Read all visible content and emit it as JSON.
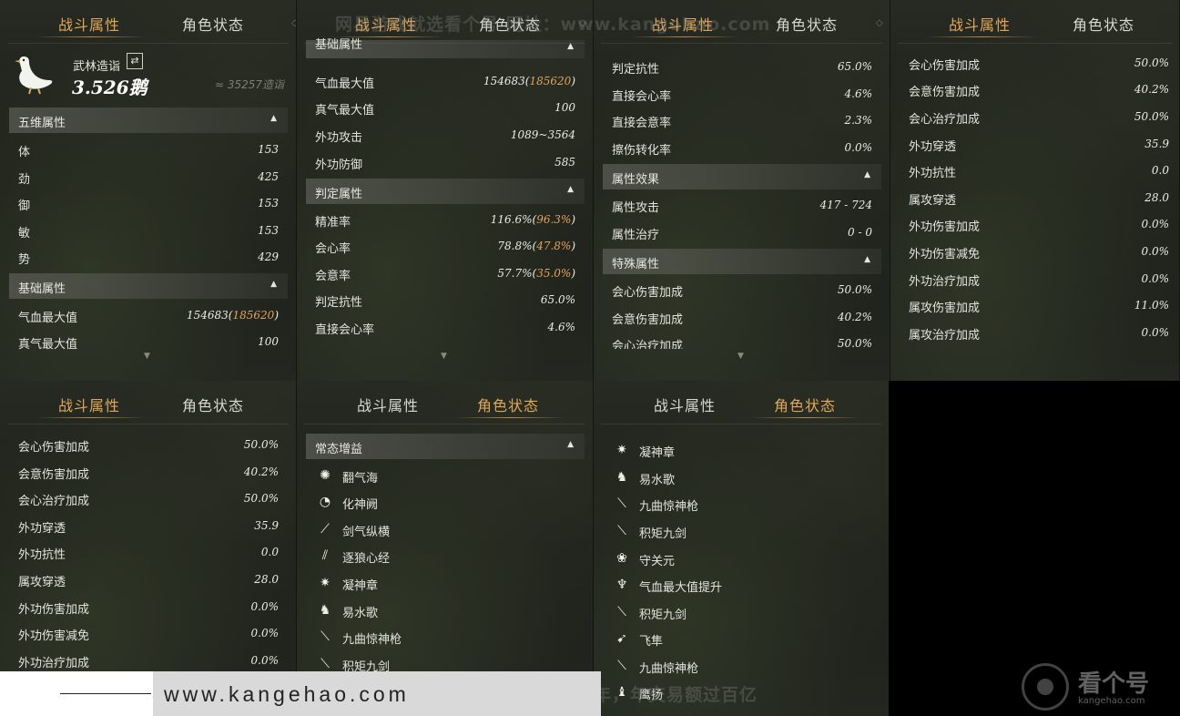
{
  "tabs": {
    "combat": "战斗属性",
    "status": "角色状态"
  },
  "watermarks": {
    "top": "网易游戏就选看个号  网址：www.kangehao.com",
    "bottom": "看个号专业网易游戏八年，年交易额过百亿"
  },
  "rank": {
    "label": "武林造诣",
    "score": "3.526鹅",
    "approx": "≈ 35257造诣"
  },
  "panel1": {
    "section_wuwei": "五维属性",
    "wuwei": [
      {
        "label": "体",
        "value": "153"
      },
      {
        "label": "劲",
        "value": "425"
      },
      {
        "label": "御",
        "value": "153"
      },
      {
        "label": "敏",
        "value": "153"
      },
      {
        "label": "势",
        "value": "429"
      }
    ],
    "section_jichu": "基础属性",
    "jichu": [
      {
        "label": "气血最大值",
        "value": "154683(",
        "extra": "185620",
        "close": ")"
      },
      {
        "label": "真气最大值",
        "value": "100"
      }
    ]
  },
  "panel2": {
    "partial_header": "基础属性",
    "jichu": [
      {
        "label": "气血最大值",
        "value": "154683(",
        "extra": "185620",
        "close": ")"
      },
      {
        "label": "真气最大值",
        "value": "100"
      },
      {
        "label": "外功攻击",
        "value": "1089~3564"
      },
      {
        "label": "外功防御",
        "value": "585"
      }
    ],
    "section_panding": "判定属性",
    "panding": [
      {
        "label": "精准率",
        "value": "116.6%(",
        "extra": "96.3%",
        "close": ")"
      },
      {
        "label": "会心率",
        "value": "78.8%(",
        "extra": "47.8%",
        "close": ")"
      },
      {
        "label": "会意率",
        "value": "57.7%(",
        "extra": "35.0%",
        "close": ")"
      },
      {
        "label": "判定抗性",
        "value": "65.0%"
      },
      {
        "label": "直接会心率",
        "value": "4.6%"
      }
    ]
  },
  "panel3": {
    "rows_top": [
      {
        "label": "判定抗性",
        "value": "65.0%"
      },
      {
        "label": "直接会心率",
        "value": "4.6%"
      },
      {
        "label": "直接会意率",
        "value": "2.3%"
      },
      {
        "label": "擦伤转化率",
        "value": "0.0%"
      }
    ],
    "section_shuxing": "属性效果",
    "shuxing": [
      {
        "label": "属性攻击",
        "value": "417 - 724"
      },
      {
        "label": "属性治疗",
        "value": "0 - 0"
      }
    ],
    "section_teshu": "特殊属性",
    "teshu": [
      {
        "label": "会心伤害加成",
        "value": "50.0%"
      },
      {
        "label": "会意伤害加成",
        "value": "40.2%"
      },
      {
        "label": "会心治疗加成",
        "value": "50.0%"
      }
    ]
  },
  "panel4": {
    "rows": [
      {
        "label": "会心伤害加成",
        "value": "50.0%"
      },
      {
        "label": "会意伤害加成",
        "value": "40.2%"
      },
      {
        "label": "会心治疗加成",
        "value": "50.0%"
      },
      {
        "label": "外功穿透",
        "value": "35.9"
      },
      {
        "label": "外功抗性",
        "value": "0.0"
      },
      {
        "label": "属攻穿透",
        "value": "28.0"
      },
      {
        "label": "外功伤害加成",
        "value": "0.0%"
      },
      {
        "label": "外功伤害减免",
        "value": "0.0%"
      },
      {
        "label": "外功治疗加成",
        "value": "0.0%"
      },
      {
        "label": "属攻伤害加成",
        "value": "11.0%"
      },
      {
        "label": "属攻治疗加成",
        "value": "0.0%"
      }
    ]
  },
  "panel5": {
    "rows": [
      {
        "label": "会心伤害加成",
        "value": "50.0%"
      },
      {
        "label": "会意伤害加成",
        "value": "40.2%"
      },
      {
        "label": "会心治疗加成",
        "value": "50.0%"
      },
      {
        "label": "外功穿透",
        "value": "35.9"
      },
      {
        "label": "外功抗性",
        "value": "0.0"
      },
      {
        "label": "属攻穿透",
        "value": "28.0"
      },
      {
        "label": "外功伤害加成",
        "value": "0.0%"
      },
      {
        "label": "外功伤害减免",
        "value": "0.0%"
      },
      {
        "label": "外功治疗加成",
        "value": "0.0%"
      }
    ]
  },
  "panel6": {
    "section_buff": "常态增益",
    "buffs": [
      {
        "name": "翻气海",
        "icon": "burst-icon"
      },
      {
        "name": "化神阙",
        "icon": "swirl-icon"
      },
      {
        "name": "剑气纵横",
        "icon": "sword-icon"
      },
      {
        "name": "逐狼心经",
        "icon": "claw-icon"
      },
      {
        "name": "凝神章",
        "icon": "spark-icon"
      },
      {
        "name": "易水歌",
        "icon": "horse-icon"
      },
      {
        "name": "九曲惊神枪",
        "icon": "spear-icon"
      },
      {
        "name": "积矩九剑",
        "icon": "blade-icon"
      }
    ]
  },
  "panel7": {
    "buffs": [
      {
        "name": "凝神章",
        "icon": "spark-icon"
      },
      {
        "name": "易水歌",
        "icon": "horse-icon"
      },
      {
        "name": "九曲惊神枪",
        "icon": "spear-icon"
      },
      {
        "name": "积矩九剑",
        "icon": "blade-icon"
      },
      {
        "name": "守关元",
        "icon": "lotus-icon"
      },
      {
        "name": "气血最大值提升",
        "icon": "figure-icon"
      },
      {
        "name": "积矩九剑",
        "icon": "blade-icon"
      },
      {
        "name": "飞隼",
        "icon": "bird-icon"
      },
      {
        "name": "九曲惊神枪",
        "icon": "spear-icon"
      },
      {
        "name": "鹰扬",
        "icon": "eagle-icon"
      }
    ]
  },
  "footer": {
    "url": "www.kangehao.com"
  },
  "logo": {
    "name": "看个号",
    "url": "kangehao.com"
  }
}
